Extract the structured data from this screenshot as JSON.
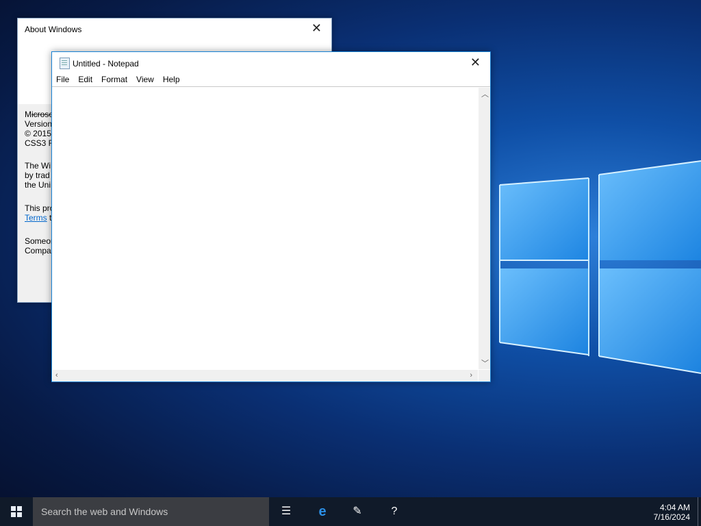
{
  "about_dialog": {
    "title": "About Windows",
    "lines": [
      "Microso",
      "Version",
      "© 2015",
      "CSS3 Re"
    ],
    "para2": [
      "The Wi",
      "by trad",
      "the Uni"
    ],
    "para3_line": "This pro",
    "terms_link": "Terms",
    "terms_rest": " t",
    "para4": [
      "Someor",
      "Compa"
    ]
  },
  "notepad": {
    "title": "Untitled - Notepad",
    "menu": [
      "File",
      "Edit",
      "Format",
      "View",
      "Help"
    ],
    "content": ""
  },
  "taskbar": {
    "search_placeholder": "Search the web and Windows",
    "time": "4:04 AM",
    "date": "7/16/2024",
    "icons": [
      "task-view-icon",
      "edge-icon",
      "notes-icon",
      "help-icon"
    ]
  },
  "colors": {
    "accent": "#1883d7",
    "taskbar": "#101a29"
  }
}
